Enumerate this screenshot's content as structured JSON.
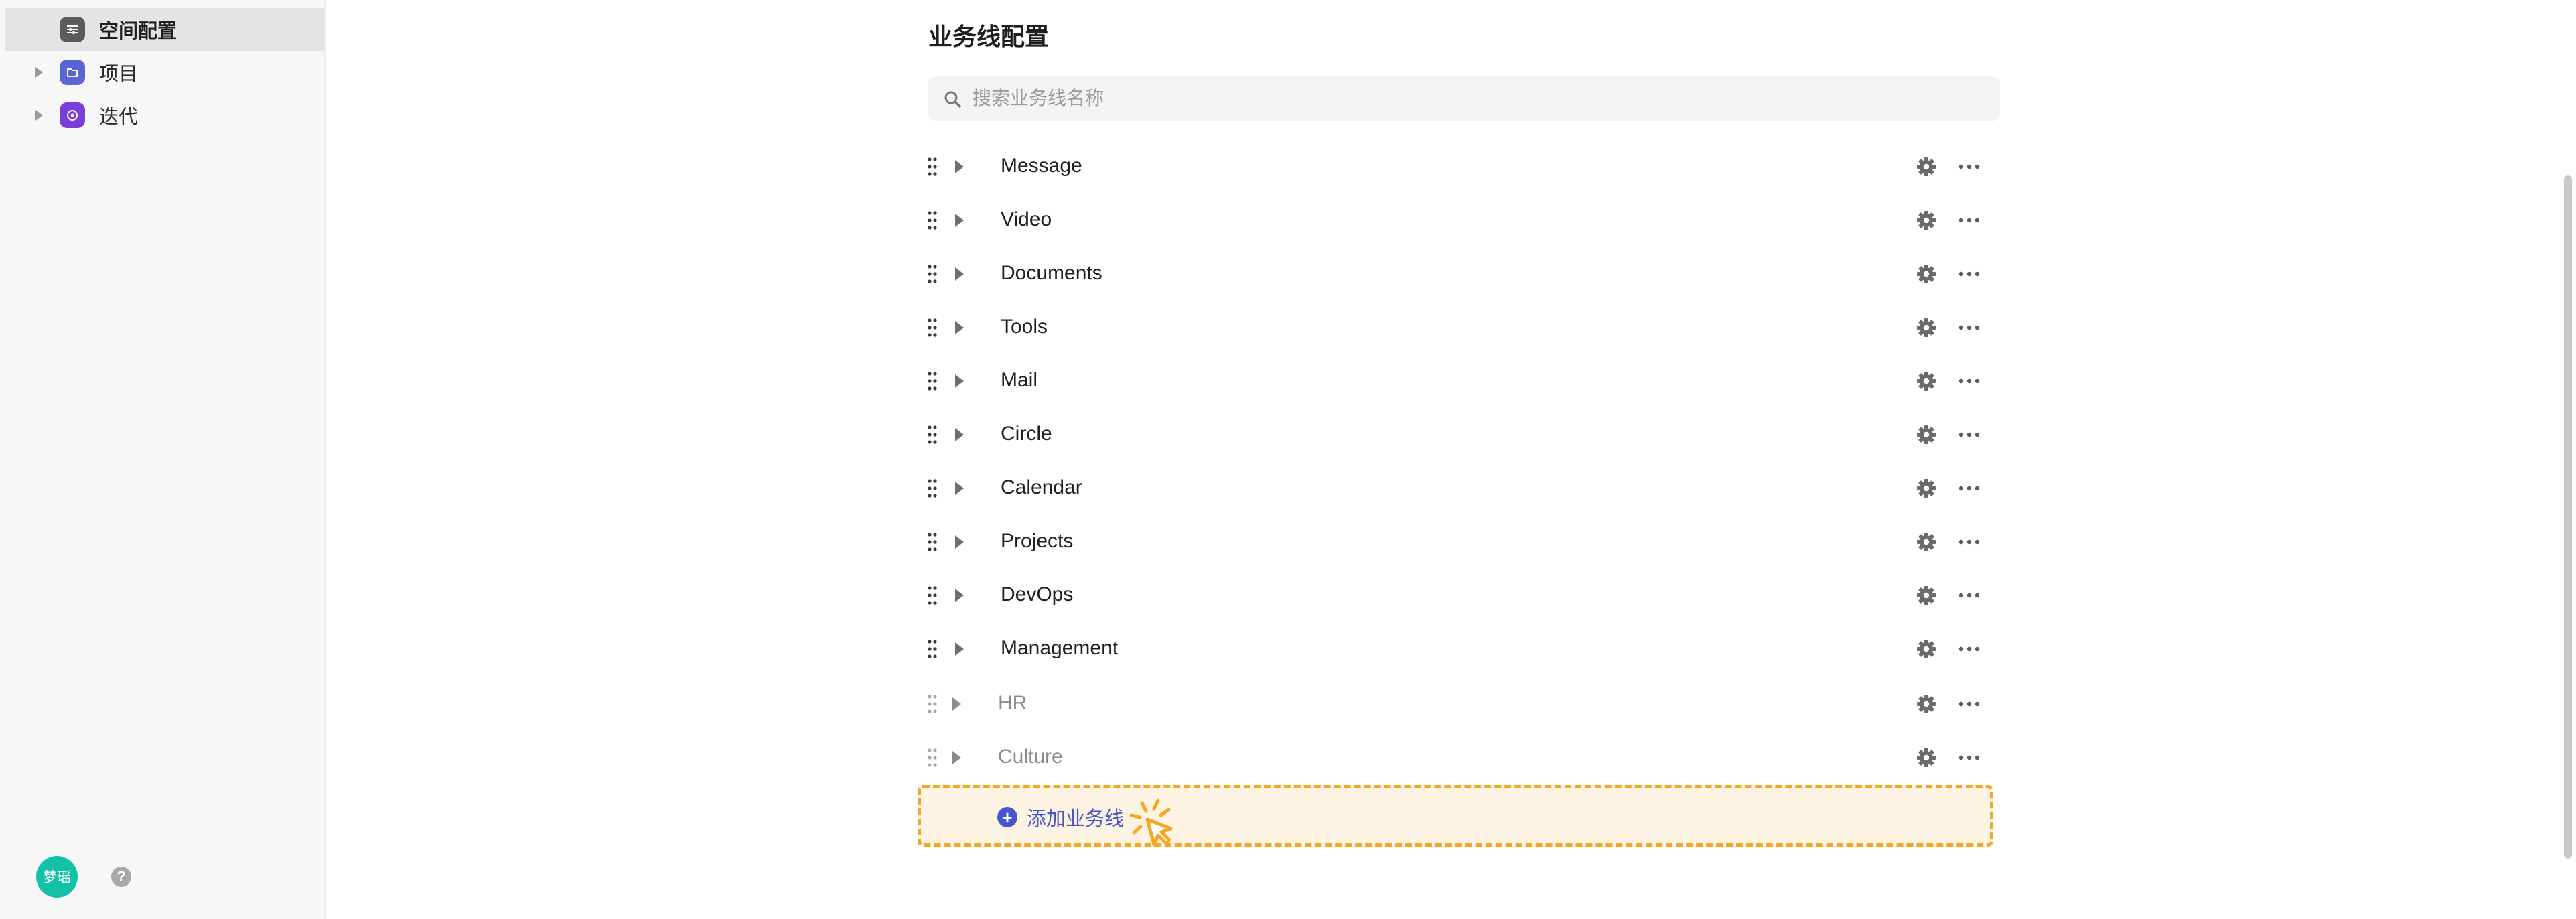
{
  "sidebar": {
    "items": [
      {
        "label": "空间配置",
        "active": true,
        "icon": "sliders-icon",
        "color": "#5b5b5b"
      },
      {
        "label": "项目",
        "active": false,
        "icon": "folder-icon",
        "color": "#5865d6"
      },
      {
        "label": "迭代",
        "active": false,
        "icon": "iteration-icon",
        "color": "#7a3fd8"
      }
    ],
    "user_avatar": "梦瑶",
    "help": "?"
  },
  "main": {
    "title": "业务线配置",
    "search": {
      "placeholder": "搜索业务线名称",
      "value": ""
    },
    "business_lines": [
      {
        "name": "Message"
      },
      {
        "name": "Video"
      },
      {
        "name": "Documents"
      },
      {
        "name": "Tools"
      },
      {
        "name": "Mail"
      },
      {
        "name": "Circle"
      },
      {
        "name": "Calendar"
      },
      {
        "name": "Projects"
      },
      {
        "name": "DevOps"
      },
      {
        "name": "Management"
      },
      {
        "name": "HR"
      },
      {
        "name": "Culture"
      }
    ],
    "add_button": {
      "label": "添加业务线",
      "plus": "+"
    }
  },
  "colors": {
    "accent": "#4a56c9",
    "highlight_border": "#f5a623",
    "highlight_bg": "#fdf3e3",
    "avatar": "#13c2a6"
  }
}
